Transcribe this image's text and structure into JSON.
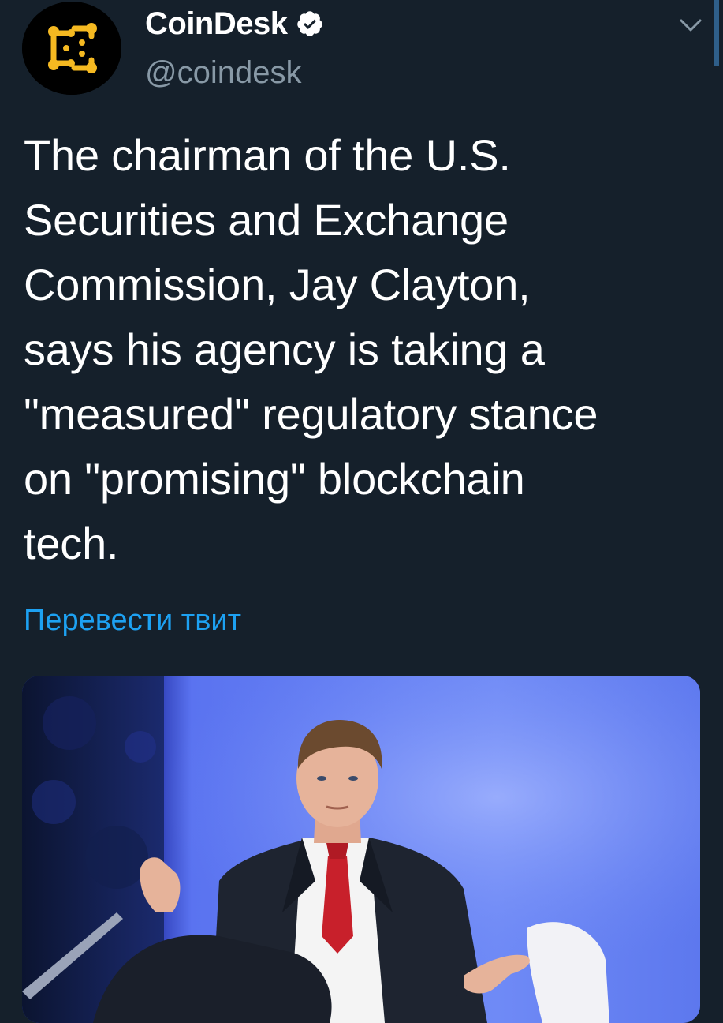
{
  "author": {
    "display_name": "CoinDesk",
    "handle": "@coindesk",
    "verified": true,
    "avatar_icon": "coindesk-logo-icon",
    "brand_color": "#f5b921"
  },
  "tweet": {
    "text_lines": [
      "The chairman of the U.S.",
      "Securities and Exchange",
      "Commission, Jay Clayton,",
      "says his agency is taking a",
      "\"measured\" regulatory stance",
      "on \"promising\" blockchain",
      "tech."
    ],
    "translate_label": "Перевести твит"
  },
  "media": {
    "kind": "photo",
    "background_color": "#3d56e6"
  },
  "colors": {
    "background": "#15202b",
    "text": "#ffffff",
    "secondary_text": "#8899a6",
    "link": "#1da1f2"
  }
}
